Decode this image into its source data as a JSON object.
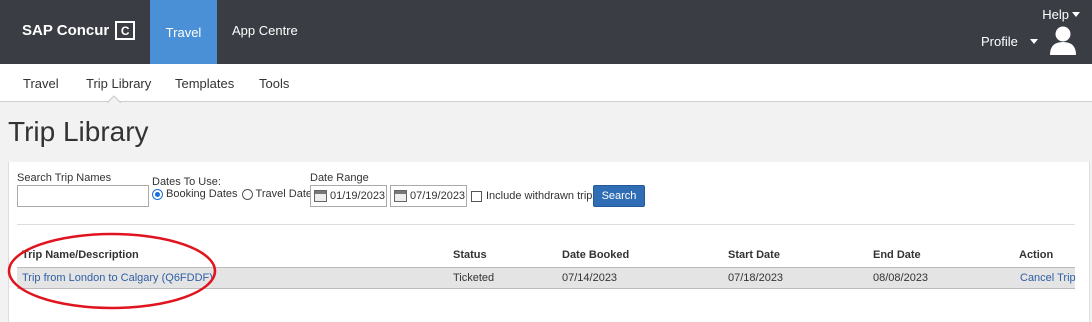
{
  "header": {
    "brand": "SAP Concur",
    "brand_mark": "C",
    "nav": [
      "Travel",
      "App Centre"
    ],
    "help_label": "Help",
    "profile_label": "Profile"
  },
  "subnav": {
    "items": [
      "Travel",
      "Trip Library",
      "Templates",
      "Tools"
    ]
  },
  "page": {
    "title": "Trip Library"
  },
  "search": {
    "trip_names_label": "Search Trip Names",
    "trip_names_value": "",
    "dates_to_use_label": "Dates To Use:",
    "booking_dates_label": "Booking Dates",
    "travel_dates_label": "Travel Dates",
    "selected_dates": "Booking Dates",
    "date_range_label": "Date Range",
    "date_from": "01/19/2023",
    "date_to": "07/19/2023",
    "include_withdrawn_label": "Include withdrawn trips",
    "include_withdrawn_checked": false,
    "search_button": "Search"
  },
  "table": {
    "columns": [
      "Trip Name/Description",
      "Status",
      "Date Booked",
      "Start Date",
      "End Date",
      "Action"
    ],
    "rows": [
      {
        "name": "Trip from London to Calgary (Q6FDDF)",
        "status": "Ticketed",
        "date_booked": "07/14/2023",
        "start_date": "07/18/2023",
        "end_date": "08/08/2023",
        "action": "Cancel Trip"
      }
    ]
  },
  "colors": {
    "topbar": "#3b3d45",
    "active_nav": "#4a90d6",
    "button": "#2f6db5",
    "link": "#2f5fa5",
    "annotation": "#e0141e"
  },
  "icons": [
    "calendar-icon",
    "user-avatar-icon",
    "caret-down-icon"
  ]
}
